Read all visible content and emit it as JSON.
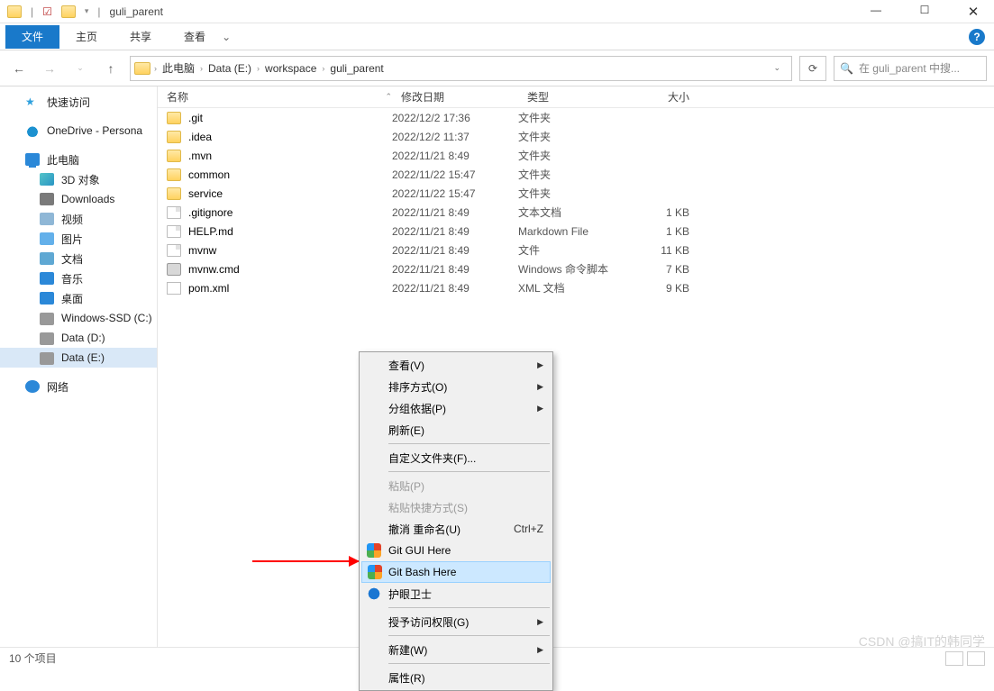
{
  "window_title": "guli_parent",
  "tabs": {
    "file": "文件",
    "home": "主页",
    "share": "共享",
    "view": "查看"
  },
  "breadcrumbs": [
    "此电脑",
    "Data (E:)",
    "workspace",
    "guli_parent"
  ],
  "search_placeholder": "在 guli_parent 中搜...",
  "columns": {
    "name": "名称",
    "date": "修改日期",
    "type": "类型",
    "size": "大小"
  },
  "sidebar": {
    "quick": "快速访问",
    "onedrive": "OneDrive - Persona",
    "pc": "此电脑",
    "obj3d": "3D 对象",
    "downloads": "Downloads",
    "videos": "视频",
    "pictures": "图片",
    "documents": "文档",
    "music": "音乐",
    "desktop": "桌面",
    "ssd": "Windows-SSD (C:)",
    "datad": "Data (D:)",
    "datae": "Data (E:)",
    "network": "网络"
  },
  "files": [
    {
      "name": ".git",
      "date": "2022/12/2 17:36",
      "type": "文件夹",
      "size": "",
      "icon": "folder"
    },
    {
      "name": ".idea",
      "date": "2022/12/2 11:37",
      "type": "文件夹",
      "size": "",
      "icon": "folder"
    },
    {
      "name": ".mvn",
      "date": "2022/11/21 8:49",
      "type": "文件夹",
      "size": "",
      "icon": "folder"
    },
    {
      "name": "common",
      "date": "2022/11/22 15:47",
      "type": "文件夹",
      "size": "",
      "icon": "folder"
    },
    {
      "name": "service",
      "date": "2022/11/22 15:47",
      "type": "文件夹",
      "size": "",
      "icon": "folder"
    },
    {
      "name": ".gitignore",
      "date": "2022/11/21 8:49",
      "type": "文本文档",
      "size": "1 KB",
      "icon": "file"
    },
    {
      "name": "HELP.md",
      "date": "2022/11/21 8:49",
      "type": "Markdown File",
      "size": "1 KB",
      "icon": "file"
    },
    {
      "name": "mvnw",
      "date": "2022/11/21 8:49",
      "type": "文件",
      "size": "11 KB",
      "icon": "file"
    },
    {
      "name": "mvnw.cmd",
      "date": "2022/11/21 8:49",
      "type": "Windows 命令脚本",
      "size": "7 KB",
      "icon": "cmd"
    },
    {
      "name": "pom.xml",
      "date": "2022/11/21 8:49",
      "type": "XML 文档",
      "size": "9 KB",
      "icon": "xml"
    }
  ],
  "status": "10 个项目",
  "context_menu": [
    {
      "label": "查看(V)",
      "arrow": true
    },
    {
      "label": "排序方式(O)",
      "arrow": true
    },
    {
      "label": "分组依据(P)",
      "arrow": true
    },
    {
      "label": "刷新(E)"
    },
    {
      "sep": true
    },
    {
      "label": "自定义文件夹(F)..."
    },
    {
      "sep": true
    },
    {
      "label": "粘贴(P)",
      "disabled": true
    },
    {
      "label": "粘贴快捷方式(S)",
      "disabled": true
    },
    {
      "label": "撤消 重命名(U)",
      "shortcut": "Ctrl+Z"
    },
    {
      "label": "Git GUI Here",
      "icon": "git"
    },
    {
      "label": "Git Bash Here",
      "icon": "git",
      "hover": true
    },
    {
      "label": "护眼卫士",
      "icon": "eye"
    },
    {
      "sep": true
    },
    {
      "label": "授予访问权限(G)",
      "arrow": true
    },
    {
      "sep": true
    },
    {
      "label": "新建(W)",
      "arrow": true
    },
    {
      "sep": true
    },
    {
      "label": "属性(R)"
    }
  ],
  "watermark": "CSDN @搞IT的韩同学"
}
